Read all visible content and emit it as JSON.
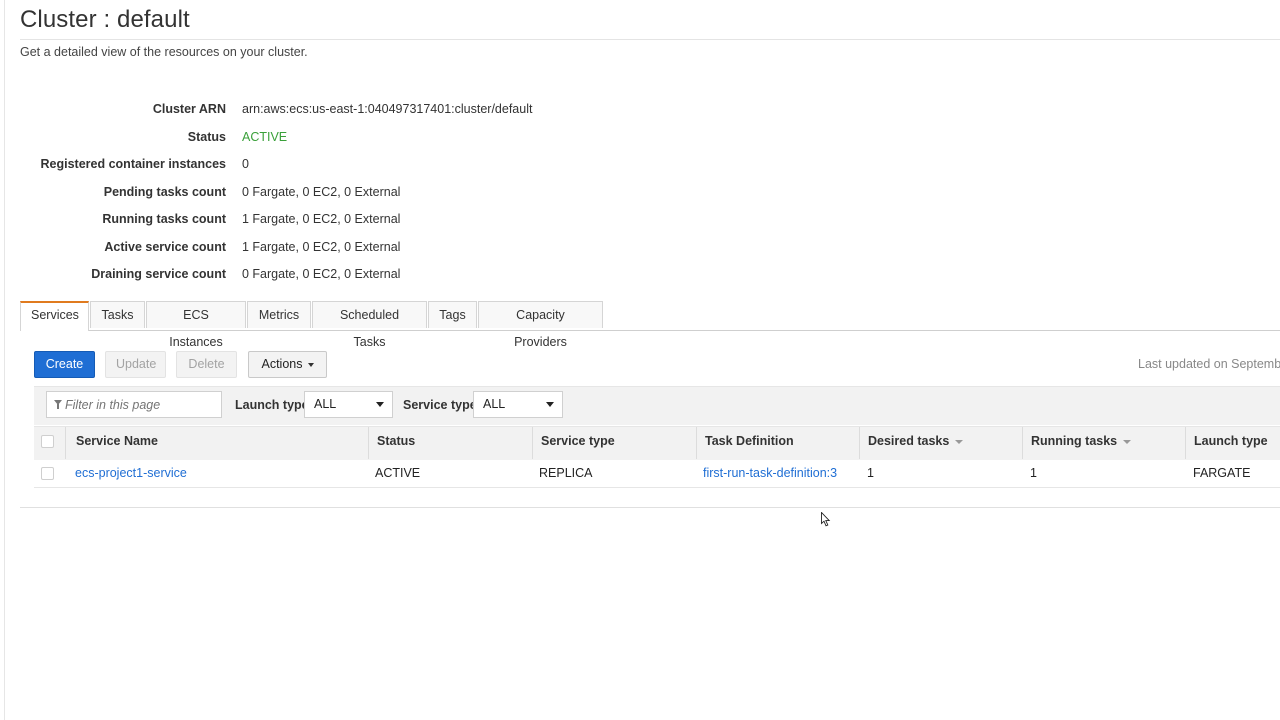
{
  "header": {
    "title": "Cluster : default",
    "description": "Get a detailed view of the resources on your cluster."
  },
  "details": [
    {
      "label": "Cluster ARN",
      "value": "arn:aws:ecs:us-east-1:040497317401:cluster/default",
      "status": false
    },
    {
      "label": "Status",
      "value": "ACTIVE",
      "status": true
    },
    {
      "label": "Registered container instances",
      "value": "0",
      "status": false
    },
    {
      "label": "Pending tasks count",
      "value": "0 Fargate, 0 EC2, 0 External",
      "status": false
    },
    {
      "label": "Running tasks count",
      "value": "1 Fargate, 0 EC2, 0 External",
      "status": false
    },
    {
      "label": "Active service count",
      "value": "1 Fargate, 0 EC2, 0 External",
      "status": false
    },
    {
      "label": "Draining service count",
      "value": "0 Fargate, 0 EC2, 0 External",
      "status": false
    }
  ],
  "tabs": [
    {
      "label": "Services",
      "selected": true
    },
    {
      "label": "Tasks",
      "selected": false
    },
    {
      "label": "ECS Instances",
      "selected": false
    },
    {
      "label": "Metrics",
      "selected": false
    },
    {
      "label": "Scheduled Tasks",
      "selected": false
    },
    {
      "label": "Tags",
      "selected": false
    },
    {
      "label": "Capacity Providers",
      "selected": false
    }
  ],
  "toolbar": {
    "create": "Create",
    "update": "Update",
    "delete": "Delete",
    "actions": "Actions",
    "last_updated": "Last updated on Septembe"
  },
  "filters": {
    "placeholder": "Filter in this page",
    "launch_type_label": "Launch type",
    "launch_type_value": "ALL",
    "service_type_label": "Service type",
    "service_type_value": "ALL"
  },
  "table": {
    "columns": [
      "Service Name",
      "Status",
      "Service type",
      "Task Definition",
      "Desired tasks",
      "Running tasks",
      "Launch type"
    ],
    "rows": [
      {
        "service_name": "ecs-project1-service",
        "status": "ACTIVE",
        "service_type": "REPLICA",
        "task_definition": "first-run-task-definition:3",
        "desired_tasks": "1",
        "running_tasks": "1",
        "launch_type": "FARGATE"
      }
    ]
  },
  "colors": {
    "primary": "#1f6ed4",
    "active": "#3aa03a",
    "tab_accent": "#e07b1f"
  },
  "icons": {
    "filter": "filter-icon",
    "dropdown": "chevron-down-icon",
    "sort": "sort-desc-icon",
    "cursor": "mouse-pointer-icon"
  }
}
